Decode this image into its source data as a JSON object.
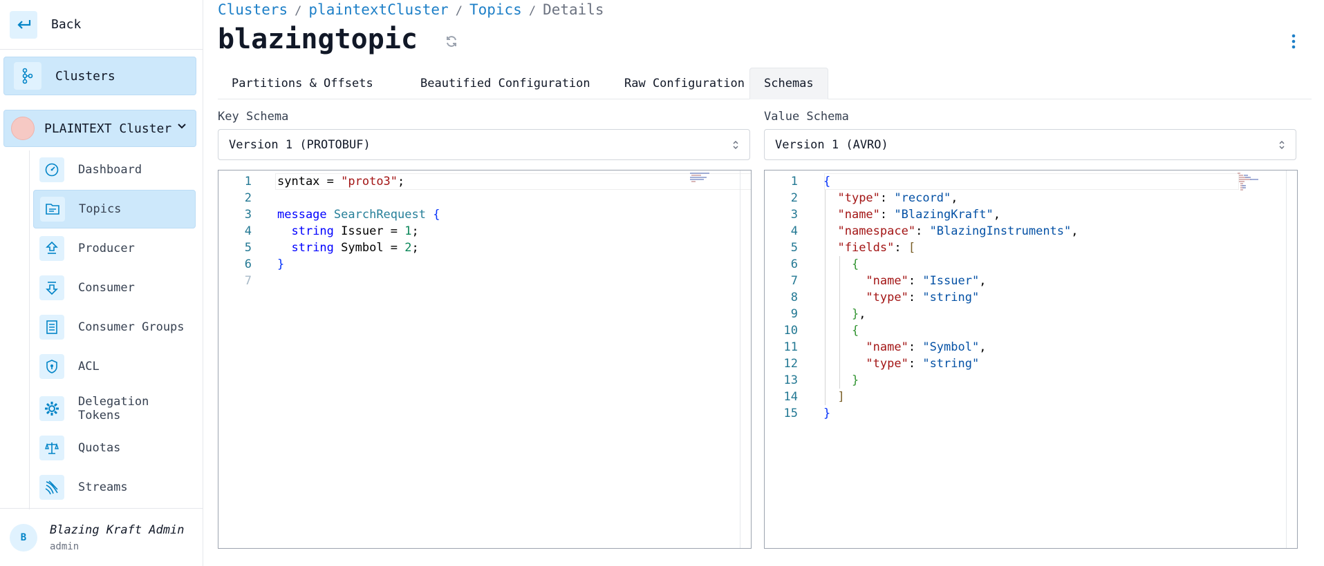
{
  "sidebar": {
    "back_label": "Back",
    "clusters_label": "Clusters",
    "cluster_name": "PLAINTEXT Cluster",
    "items": [
      {
        "label": "Dashboard",
        "icon": "gauge-icon"
      },
      {
        "label": "Topics",
        "icon": "topics-icon",
        "active": true
      },
      {
        "label": "Producer",
        "icon": "producer-icon"
      },
      {
        "label": "Consumer",
        "icon": "consumer-icon"
      },
      {
        "label": "Consumer Groups",
        "icon": "consumer-groups-icon"
      },
      {
        "label": "ACL",
        "icon": "shield-icon"
      },
      {
        "label": "Delegation Tokens",
        "icon": "gear-icon"
      },
      {
        "label": "Quotas",
        "icon": "scale-icon"
      },
      {
        "label": "Streams",
        "icon": "streams-icon"
      }
    ],
    "user": {
      "avatar": "B",
      "name": "Blazing Kraft Admin",
      "role": "admin"
    }
  },
  "breadcrumb": {
    "c1": "Clusters",
    "c2": "plaintextCluster",
    "c3": "Topics",
    "current": "Details",
    "sep": "/"
  },
  "page_title": "blazingtopic",
  "tabs": [
    "Partitions & Offsets",
    "Beautified Configuration",
    "Raw Configuration",
    "Schemas"
  ],
  "active_tab": "Schemas",
  "key_schema": {
    "label": "Key Schema",
    "selected": "Version 1 (PROTOBUF)",
    "lines": [
      [
        [
          "syntax",
          "plain"
        ],
        [
          " = ",
          "plain"
        ],
        [
          "\"proto3\"",
          "str"
        ],
        [
          ";",
          "plain"
        ]
      ],
      [],
      [
        [
          "message",
          "kw"
        ],
        [
          " ",
          "plain"
        ],
        [
          "SearchRequest",
          "type"
        ],
        [
          " {",
          "brace"
        ]
      ],
      [
        [
          "  ",
          "plain"
        ],
        [
          "string",
          "kw"
        ],
        [
          " Issuer = ",
          "plain"
        ],
        [
          "1",
          "num"
        ],
        [
          ";",
          "plain"
        ]
      ],
      [
        [
          "  ",
          "plain"
        ],
        [
          "string",
          "kw"
        ],
        [
          " Symbol = ",
          "plain"
        ],
        [
          "2",
          "num"
        ],
        [
          ";",
          "plain"
        ]
      ],
      [
        [
          "}",
          "brace"
        ]
      ],
      []
    ]
  },
  "value_schema": {
    "label": "Value Schema",
    "selected": "Version 1 (AVRO)",
    "lines": [
      [
        [
          "{",
          "brace"
        ]
      ],
      [
        [
          "  ",
          "plain"
        ],
        [
          "\"type\"",
          "key"
        ],
        [
          ": ",
          "plain"
        ],
        [
          "\"record\"",
          "val"
        ],
        [
          ",",
          "plain"
        ]
      ],
      [
        [
          "  ",
          "plain"
        ],
        [
          "\"name\"",
          "key"
        ],
        [
          ": ",
          "plain"
        ],
        [
          "\"BlazingKraft\"",
          "val"
        ],
        [
          ",",
          "plain"
        ]
      ],
      [
        [
          "  ",
          "plain"
        ],
        [
          "\"namespace\"",
          "key"
        ],
        [
          ": ",
          "plain"
        ],
        [
          "\"BlazingInstruments\"",
          "val"
        ],
        [
          ",",
          "plain"
        ]
      ],
      [
        [
          "  ",
          "plain"
        ],
        [
          "\"fields\"",
          "key"
        ],
        [
          ": ",
          "plain"
        ],
        [
          "[",
          "brack"
        ]
      ],
      [
        [
          "    ",
          "plain"
        ],
        [
          "{",
          "brack2"
        ]
      ],
      [
        [
          "      ",
          "plain"
        ],
        [
          "\"name\"",
          "key"
        ],
        [
          ": ",
          "plain"
        ],
        [
          "\"Issuer\"",
          "val"
        ],
        [
          ",",
          "plain"
        ]
      ],
      [
        [
          "      ",
          "plain"
        ],
        [
          "\"type\"",
          "key"
        ],
        [
          ": ",
          "plain"
        ],
        [
          "\"string\"",
          "val"
        ]
      ],
      [
        [
          "    ",
          "plain"
        ],
        [
          "}",
          "brack2"
        ],
        [
          ",",
          "plain"
        ]
      ],
      [
        [
          "    ",
          "plain"
        ],
        [
          "{",
          "brack2"
        ]
      ],
      [
        [
          "      ",
          "plain"
        ],
        [
          "\"name\"",
          "key"
        ],
        [
          ": ",
          "plain"
        ],
        [
          "\"Symbol\"",
          "val"
        ],
        [
          ",",
          "plain"
        ]
      ],
      [
        [
          "      ",
          "plain"
        ],
        [
          "\"type\"",
          "key"
        ],
        [
          ": ",
          "plain"
        ],
        [
          "\"string\"",
          "val"
        ]
      ],
      [
        [
          "    ",
          "plain"
        ],
        [
          "}",
          "brack2"
        ]
      ],
      [
        [
          "  ",
          "plain"
        ],
        [
          "]",
          "brack"
        ]
      ],
      [
        [
          "}",
          "brace"
        ]
      ]
    ]
  },
  "colors": {
    "accent": "#1d7fc7",
    "active_bg": "#cde8fb",
    "icon_bg": "#e0f2fe"
  }
}
